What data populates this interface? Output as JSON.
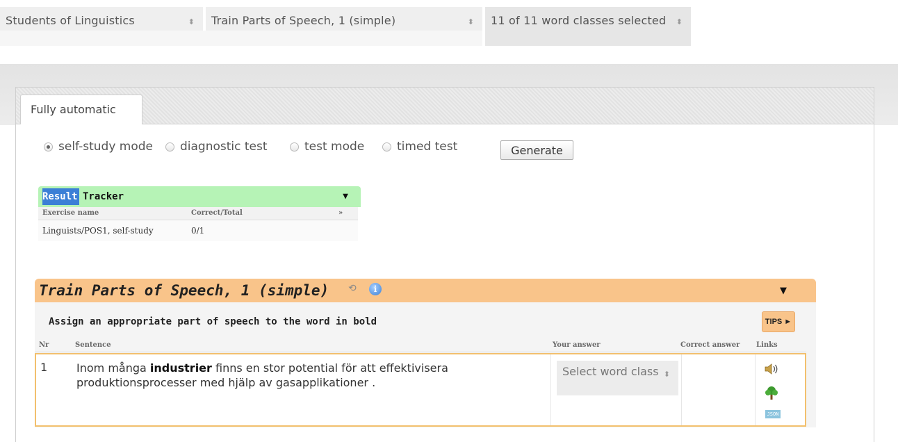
{
  "filters": {
    "group": "Students of Linguistics",
    "exercise": "Train Parts of Speech, 1 (simple)",
    "word_classes": "11 of 11 word classes selected"
  },
  "tabs": [
    {
      "label": "Fully automatic",
      "active": true
    }
  ],
  "modes": {
    "options": [
      "self-study mode",
      "diagnostic test",
      "test mode",
      "timed test"
    ],
    "selected": "self-study mode"
  },
  "generate_label": "Generate",
  "result_tracker": {
    "title_a": "Result",
    "title_b": "Tracker",
    "columns": {
      "name": "Exercise name",
      "score": "Correct/Total",
      "more": "»"
    },
    "rows": [
      {
        "name": "Linguists/POS1, self-study",
        "score": "0/1"
      }
    ]
  },
  "exercise": {
    "title": "Train Parts of Speech, 1 (simple)",
    "instruction": "Assign an appropriate part of speech to the word in bold",
    "tips_label": "TIPS ►",
    "info_glyph": "i",
    "sync_glyph": "⟲",
    "columns": {
      "nr": "Nr",
      "sentence": "Sentence",
      "your_answer": "Your answer",
      "correct_answer": "Correct answer",
      "links": "Links"
    },
    "rows": [
      {
        "nr": "1",
        "before": "Inom många ",
        "bold": "industrier",
        "after": " finns en stor potential för att effektivisera produktionsprocesser med hjälp av gasapplikationer .",
        "answer_placeholder": "Select word class",
        "correct_answer": "",
        "json_label": "JSON"
      }
    ]
  },
  "icons": {
    "speaker": "speaker-icon",
    "tree": "tree-icon",
    "info": "info-icon",
    "caret": "caret-down-icon"
  },
  "colors": {
    "tracker_header": "#b6f3b6",
    "exercise_header": "#f9c48a",
    "row_border": "#f2c06e",
    "highlight": "#3b7fd6"
  }
}
